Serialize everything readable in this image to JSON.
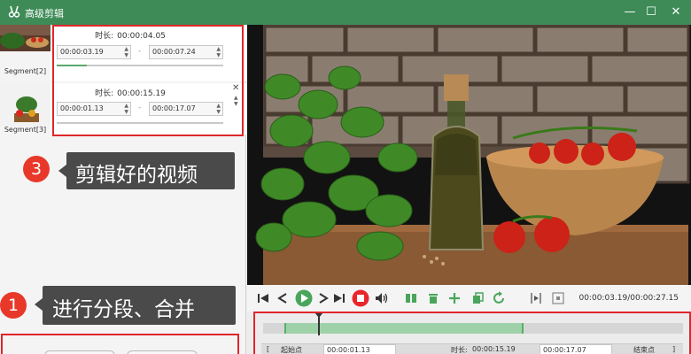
{
  "window": {
    "title": "高级剪辑",
    "minimize": "—",
    "maximize": "☐",
    "close": "✕"
  },
  "segments": [
    {
      "label": "Segment[2]",
      "duration_label": "时长:",
      "duration": "00:00:04.05",
      "start": "00:00:03.19",
      "end": "00:00:07.24",
      "separator": "-",
      "progress": 0.18
    },
    {
      "label": "Segment[3]",
      "duration_label": "时长:",
      "duration": "00:00:15.19",
      "start": "00:00:01.13",
      "end": "00:00:17.07",
      "separator": "-",
      "progress": 0.0
    }
  ],
  "annotations": {
    "edited": {
      "number": "3",
      "text": "剪辑好的视频"
    },
    "split_merge": {
      "number": "1",
      "text": "进行分段、合并"
    }
  },
  "player": {
    "current_time": "00:00:03.19",
    "total_time": "00:00:27.15",
    "time_separator": "/",
    "icons": [
      "skip-start-icon",
      "prev-frame-icon",
      "play-icon",
      "next-frame-icon",
      "skip-end-icon",
      "stop-icon",
      "volume-icon",
      "split-icon",
      "delete-icon",
      "add-icon",
      "copy-icon",
      "rotate-icon",
      "mark-in-icon",
      "mark-out-icon"
    ]
  },
  "timeline": {
    "start_label": "起始点",
    "start_value": "00:00:01.13",
    "duration_label": "时长:",
    "duration_value": "00:00:15.19",
    "end_value": "00:00:17.07",
    "end_label": "结束点",
    "playhead_fraction": 0.13,
    "selection_start_fraction": 0.05,
    "selection_end_fraction": 0.62
  },
  "colors": {
    "titlebar": "#3e8b57",
    "highlight_border": "#e0262b",
    "badge": "#e8382a",
    "accent_green": "#5aa96b",
    "stop_red": "#e8262b"
  }
}
